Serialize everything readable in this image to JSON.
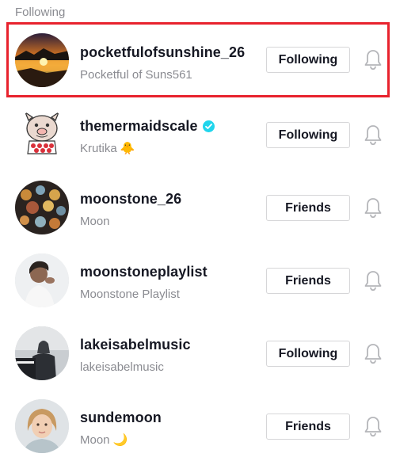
{
  "section": {
    "label": "Following"
  },
  "accounts": [
    {
      "username": "pocketfulofsunshine_26",
      "nickname": "Pocketful of Suns561",
      "verified": false,
      "button": "Following",
      "avatar": "sunset-lake-avatar",
      "highlighted": true
    },
    {
      "username": "themermaidscale",
      "nickname": "Krutika",
      "nickname_emoji": "🐥",
      "verified": true,
      "button": "Following",
      "avatar": "cartoon-pig-avatar"
    },
    {
      "username": "moonstone_26",
      "nickname": "Moon",
      "verified": false,
      "button": "Friends",
      "avatar": "lanterns-avatar"
    },
    {
      "username": "moonstoneplaylist",
      "nickname": "Moonstone Playlist",
      "verified": false,
      "button": "Friends",
      "avatar": "woman-portrait-avatar"
    },
    {
      "username": "lakeisabelmusic",
      "nickname": "lakeisabelmusic",
      "verified": false,
      "button": "Following",
      "avatar": "piano-player-avatar"
    },
    {
      "username": "sundemoon",
      "nickname": "Moon",
      "nickname_emoji": "🌙",
      "verified": false,
      "button": "Friends",
      "avatar": "girl-portrait-avatar"
    }
  ],
  "colors": {
    "highlight": "#e8222d",
    "verified": "#20d5ec",
    "secondary_text": "#8a8b91",
    "button_border": "#d6d6d8"
  }
}
